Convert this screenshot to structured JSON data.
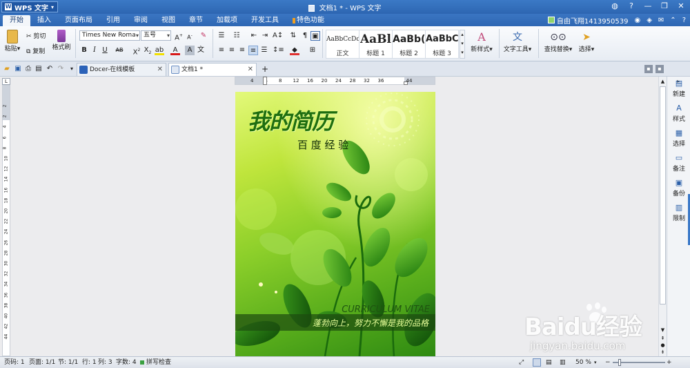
{
  "titlebar": {
    "app_menu_label": "WPS 文字",
    "title": "文档1 * - WPS 文字"
  },
  "menubar": {
    "tabs": [
      "开始",
      "插入",
      "页面布局",
      "引用",
      "审阅",
      "视图",
      "章节",
      "加载项",
      "开发工具",
      "特色功能"
    ],
    "user": "自由飞翔1413950539"
  },
  "ribbon": {
    "paste": "粘贴",
    "cut": "剪切",
    "copy": "复制",
    "format_painter": "格式刷",
    "font_name": "Times New Roma",
    "font_size": "五号",
    "styles": [
      {
        "preview": "AaBbCcDd",
        "name": "正文"
      },
      {
        "preview": "AaBl",
        "name": "标题 1"
      },
      {
        "preview": "AaBb(",
        "name": "标题 2"
      },
      {
        "preview": "AaBbC",
        "name": "标题 3"
      }
    ],
    "new_style": "新样式",
    "text_tools": "文字工具",
    "find_replace": "查找替换",
    "select": "选择"
  },
  "tabs": {
    "docer": "Docer-在线模板",
    "doc1": "文档1 *"
  },
  "ruler": {
    "h_ticks": [
      "4",
      "4",
      "8",
      "12",
      "16",
      "20",
      "24",
      "28",
      "32",
      "36",
      "44"
    ],
    "v_ticks": [
      "2",
      "2",
      "4",
      "6",
      "8",
      "10",
      "12",
      "14",
      "16",
      "18",
      "20",
      "22",
      "24",
      "26",
      "28",
      "30",
      "32",
      "34",
      "36",
      "38",
      "40",
      "42",
      "44"
    ]
  },
  "page": {
    "cover_title": "我的简历",
    "subtitle": "百 度 经 验",
    "curriculum": "CURRICULUM VITAE",
    "motto": "蓬勃向上，努力不懈是我的品格"
  },
  "rightpanel": {
    "items": [
      "新建",
      "样式",
      "选择",
      "备注",
      "备份",
      "限制"
    ]
  },
  "statusbar": {
    "page_code": "页码: 1",
    "pages": "页面: 1/1",
    "section": "节: 1/1",
    "row": "行: 1",
    "col": "列: 3",
    "words": "字数: 4",
    "spellcheck": "拼写检查",
    "zoom": "50 %"
  },
  "watermark": {
    "brand": "Baidu经验",
    "url": "jingyan.baidu.com"
  },
  "colors": {
    "titlebar": "#2d66b2",
    "cover_green": "#5aae1c",
    "cover_title": "#1e6e10"
  }
}
